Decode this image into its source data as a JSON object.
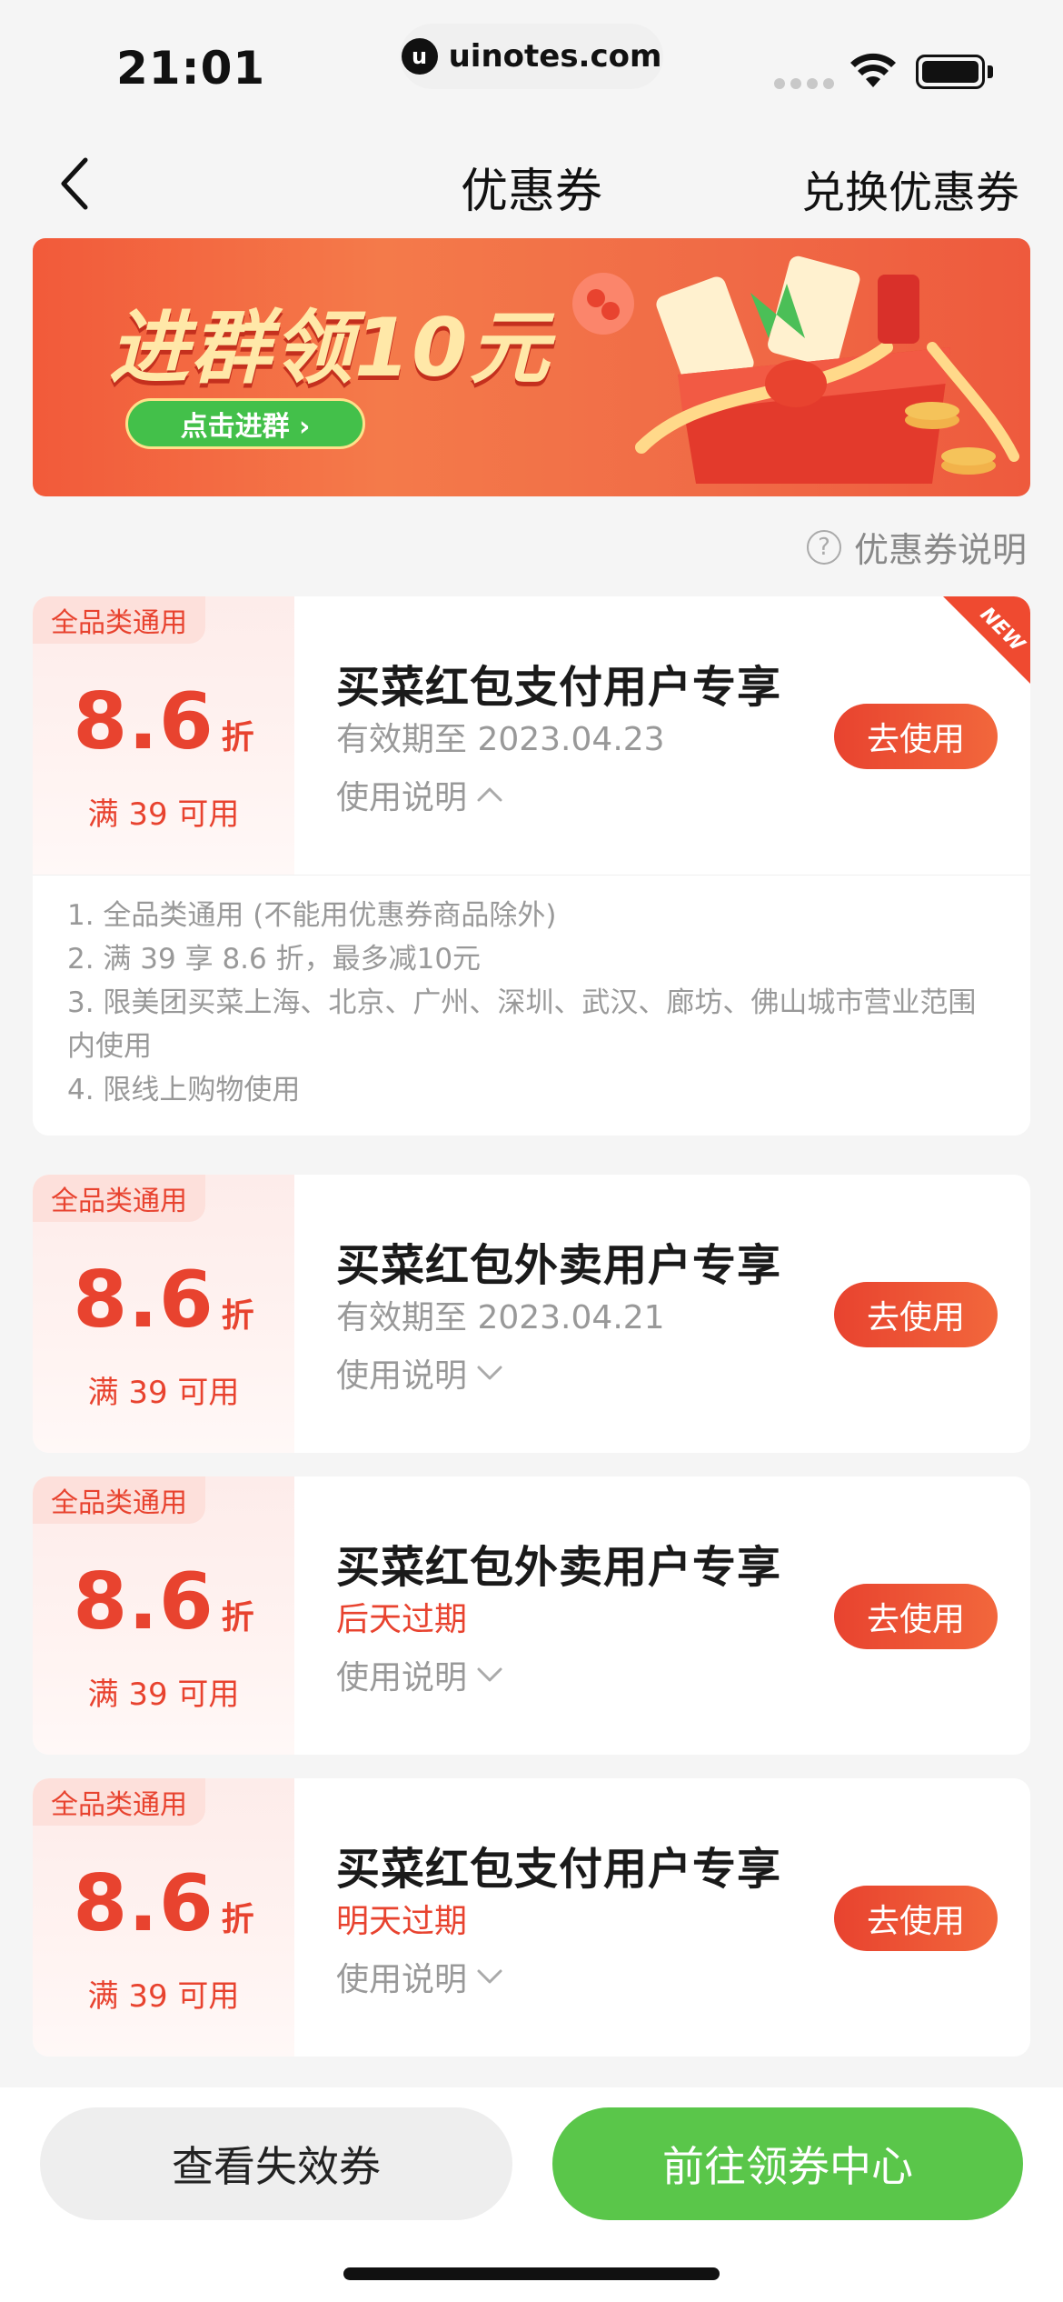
{
  "status_bar": {
    "time": "21:01",
    "url": "uinotes.com",
    "url_logo_letter": "u"
  },
  "nav": {
    "title": "优惠券",
    "right_action": "兑换优惠券"
  },
  "banner": {
    "title": "进群领10元",
    "button_label": "点击进群 ›"
  },
  "help": {
    "label": "优惠券说明",
    "icon_glyph": "?"
  },
  "coupons": [
    {
      "badge": "全品类通用",
      "discount": "8.6",
      "unit": "折",
      "min_spend": "满 39 可用",
      "title": "买菜红包支付用户专享",
      "expiry": "有效期至 2023.04.23",
      "rules_label": "使用说明",
      "button": "去使用",
      "new_tag": "NEW",
      "details": [
        "1. 全品类通用 (不能用优惠券商品除外)",
        "2. 满 39 享 8.6 折，最多减10元",
        "3. 限美团买菜上海、北京、广州、深圳、武汉、廊坊、佛山城市营业范围内使用",
        "4. 限线上购物使用"
      ]
    },
    {
      "badge": "全品类通用",
      "discount": "8.6",
      "unit": "折",
      "min_spend": "满 39 可用",
      "title": "买菜红包外卖用户专享",
      "expiry": "有效期至 2023.04.21",
      "rules_label": "使用说明",
      "button": "去使用"
    },
    {
      "badge": "全品类通用",
      "discount": "8.6",
      "unit": "折",
      "min_spend": "满 39 可用",
      "title": "买菜红包外卖用户专享",
      "expiry": "后天过期",
      "rules_label": "使用说明",
      "button": "去使用"
    },
    {
      "badge": "全品类通用",
      "discount": "8.6",
      "unit": "折",
      "min_spend": "满 39 可用",
      "title": "买菜红包支付用户专享",
      "expiry": "明天过期",
      "rules_label": "使用说明",
      "button": "去使用"
    }
  ],
  "bottom": {
    "invalid_button": "查看失效券",
    "center_button": "前往领券中心"
  },
  "colors": {
    "accent_red": "#e8432f",
    "accent_green": "#5ac64a",
    "background": "#f5f5f5"
  }
}
